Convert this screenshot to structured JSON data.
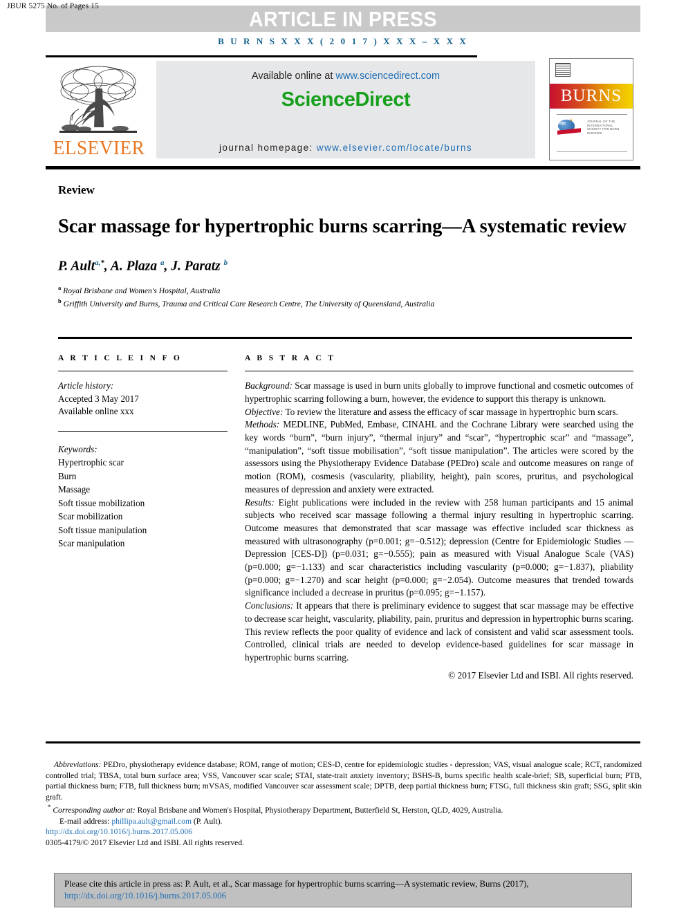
{
  "banner": {
    "jbur_code": "JBUR 5275 No. of Pages 15",
    "press_label": "ARTICLE IN PRESS",
    "journal_ref": "B U R N S  X X X  ( 2 0 1 7 )  X X X – X X X"
  },
  "masthead": {
    "elsevier_wordmark": "ELSEVIER",
    "available_prefix": "Available online at ",
    "available_url": "www.sciencedirect.com",
    "sciencedirect_logo": "ScienceDirect",
    "homepage_prefix": "journal homepage: ",
    "homepage_url": "www.elsevier.com/locate/burns",
    "cover_title": "BURNS",
    "cover_society_text": "JOURNAL OF THE INTERNATIONAL SOCIETY FOR BURN INJURIES",
    "cover_isbi_label": "ISBI"
  },
  "article": {
    "type": "Review",
    "title": "Scar massage for hypertrophic burns scarring—A systematic review",
    "authors_html": "P. Ault<sup>a,</sup><sup class=\"star\">*</sup>, A. Plaza <sup>a</sup>, J. Paratz <sup>b</sup>",
    "affiliations": [
      {
        "marker": "a",
        "text": "Royal Brisbane and Women's Hospital, Australia"
      },
      {
        "marker": "b",
        "text": "Griffith University and Burns, Trauma and Critical Care Research Centre, The University of Queensland, Australia"
      }
    ]
  },
  "article_info": {
    "heading": "A R T I C L E   I N F O",
    "history_label": "Article history:",
    "history_lines": [
      "Accepted 3 May 2017",
      "Available online xxx"
    ],
    "keywords_label": "Keywords:",
    "keywords": [
      "Hypertrophic scar",
      "Burn",
      "Massage",
      "Soft tissue mobilization",
      "Scar mobilization",
      "Soft tissue manipulation",
      "Scar manipulation"
    ]
  },
  "abstract": {
    "heading": "A B S T R A C T",
    "sections": [
      {
        "label": "Background:",
        "text": " Scar massage is used in burn units globally to improve functional and cosmetic outcomes of hypertrophic scarring following a burn, however, the evidence to support this therapy is unknown."
      },
      {
        "label": "Objective:",
        "text": " To review the literature and assess the efficacy of scar massage in hypertrophic burn scars."
      },
      {
        "label": "Methods:",
        "text": " MEDLINE, PubMed, Embase, CINAHL and the Cochrane Library were searched using the key words “burn”, “burn injury”, “thermal injury” and “scar”, “hypertrophic scar” and “massage”, “manipulation”, “soft tissue mobilisation”, “soft tissue manipulation”. The articles were scored by the assessors using the Physiotherapy Evidence Database (PEDro) scale and outcome measures on range of motion (ROM), cosmesis (vascularity, pliability, height), pain scores, pruritus, and psychological measures of depression and anxiety were extracted."
      },
      {
        "label": "Results:",
        "text": " Eight publications were included in the review with 258 human participants and 15 animal subjects who received scar massage following a thermal injury resulting in hypertrophic scarring. Outcome measures that demonstrated that scar massage was effective included scar thickness as measured with ultrasonography (p=0.001; g=−0.512); depression (Centre for Epidemiologic Studies — Depression [CES-D]) (p=0.031; g=−0.555); pain as measured with Visual Analogue Scale (VAS) (p=0.000; g=−1.133) and scar characteristics including vascularity (p=0.000; g=−1.837), pliability (p=0.000; g=−1.270) and scar height (p=0.000; g=−2.054). Outcome measures that trended towards significance included a decrease in pruritus (p=0.095; g=−1.157)."
      },
      {
        "label": "Conclusions:",
        "text": " It appears that there is preliminary evidence to suggest that scar massage may be effective to decrease scar height, vascularity, pliability, pain, pruritus and depression in hypertrophic burns scaring. This review reflects the poor quality of evidence and lack of consistent and valid scar assessment tools. Controlled, clinical trials are needed to develop evidence-based guidelines for scar massage in hypertrophic burns scarring."
      }
    ],
    "copyright": "© 2017 Elsevier Ltd and ISBI. All rights reserved."
  },
  "footnotes": {
    "abbreviations_label": "Abbreviations:",
    "abbreviations_text": " PEDro, physiotherapy evidence database; ROM, range of motion; CES-D, centre for epidemiologic studies - depression; VAS, visual analogue scale; RCT, randomized controlled trial; TBSA, total burn surface area; VSS, Vancouver scar scale; STAI, state-trait anxiety inventory; BSHS-B, burns specific health scale-brief; SB, superficial burn; PTB, partial thickness burn; FTB, full thickness burn; mVSAS, modified Vancouver scar assessment scale; DPTB, deep partial thickness burn; FTSG, full thickness skin graft; SSG, split skin graft.",
    "corresponding_label": "Corresponding author at:",
    "corresponding_text": " Royal Brisbane and Women's Hospital, Physiotherapy Department, Butterfield St, Herston, QLD, 4029, Australia.",
    "email_label": "E-mail address: ",
    "email_address": "phillipa.ault@gmail.com",
    "email_suffix": " (P. Ault).",
    "doi_url": "http://dx.doi.org/10.1016/j.burns.2017.05.006",
    "issn_line": "0305-4179/© 2017 Elsevier Ltd and ISBI. All rights reserved."
  },
  "cite_box": {
    "text": "Please cite this article in press as: P. Ault, et al., Scar massage for hypertrophic burns scarring—A systematic review, Burns (2017),",
    "url": "http://dx.doi.org/10.1016/j.burns.2017.05.006"
  },
  "colors": {
    "banner_gray": "#c9c9c9",
    "journal_ref_blue": "#14618e",
    "link_blue": "#1f6eb5",
    "sciencedirect_green": "#17a01c",
    "elsevier_orange": "#e87722",
    "sd_box_gray": "#e6e7e8",
    "cite_box_gray": "#c0c0c0",
    "burns_red": "#c8102e",
    "burns_yellow": "#f5d400"
  }
}
